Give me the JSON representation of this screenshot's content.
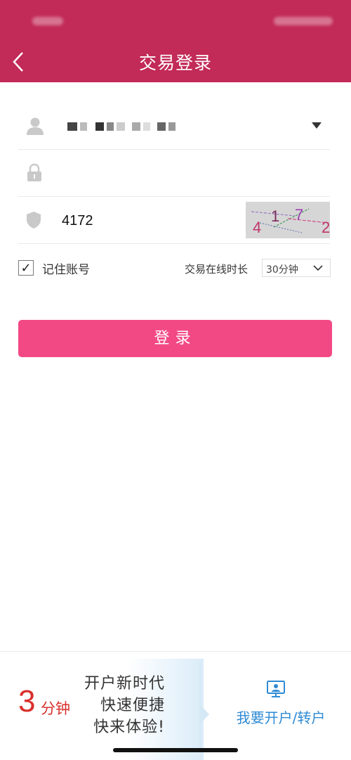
{
  "header": {
    "title": "交易登录"
  },
  "form": {
    "password_value": "",
    "captcha_value": "4172",
    "captcha_image": {
      "chars": [
        "4",
        "1",
        "7",
        "2"
      ]
    }
  },
  "options": {
    "remember_label": "记住账号",
    "remember_checked_mark": "✓",
    "duration_label": "交易在线时长",
    "duration_value": "30分钟"
  },
  "login_button": {
    "label": "登录"
  },
  "promo": {
    "number": "3",
    "unit": "分钟",
    "lines": [
      "开户新时代",
      "快速便捷",
      "快来体验!"
    ],
    "open_account_label": "我要开户/转户"
  },
  "colors": {
    "header": "#c22a57",
    "button": "#f24984",
    "promo_red": "#d9302d",
    "promo_blue": "#2f8ad4"
  },
  "icons": {
    "back": "chevron-left-icon",
    "user": "user-icon",
    "lock": "lock-icon",
    "shield": "shield-icon",
    "dropdown": "caret-down-icon",
    "account_open": "monitor-user-icon"
  }
}
